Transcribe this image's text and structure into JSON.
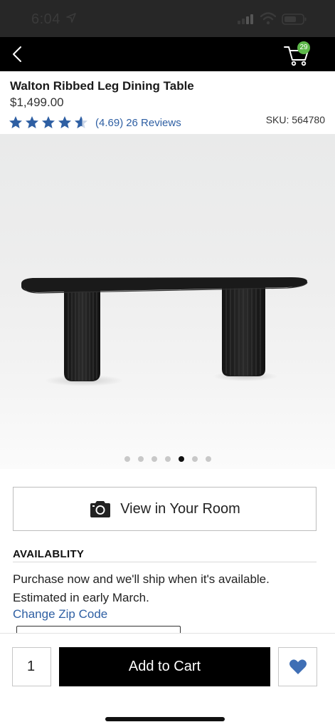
{
  "status_bar": {
    "time": "6:04"
  },
  "nav": {
    "back_icon": "chevron-left-icon",
    "cart_icon": "shopping-cart-icon",
    "cart_count": "29"
  },
  "product": {
    "title": "Walton Ribbed Leg Dining Table",
    "price": "$1,499.00",
    "rating_value": "(4.69)",
    "reviews": "26 Reviews",
    "rating": 4.69,
    "sku": "SKU: 564780"
  },
  "gallery": {
    "total_images": 7,
    "active_index": 4
  },
  "view_room": {
    "icon": "camera-icon",
    "label": "View in Your Room"
  },
  "availability": {
    "heading": "AVAILABLITY",
    "line1": "Purchase now and we'll ship when it's available.",
    "line2": "Estimated in early March.",
    "zip_link": "Change Zip Code"
  },
  "purchase_bar": {
    "quantity": "1",
    "add_to_cart": "Add to Cart",
    "favorite_icon": "heart-icon"
  },
  "colors": {
    "link_blue": "#2e5fa3",
    "badge_green": "#5db84a",
    "heart_blue": "#3f6fb5",
    "button_black": "#000000"
  }
}
